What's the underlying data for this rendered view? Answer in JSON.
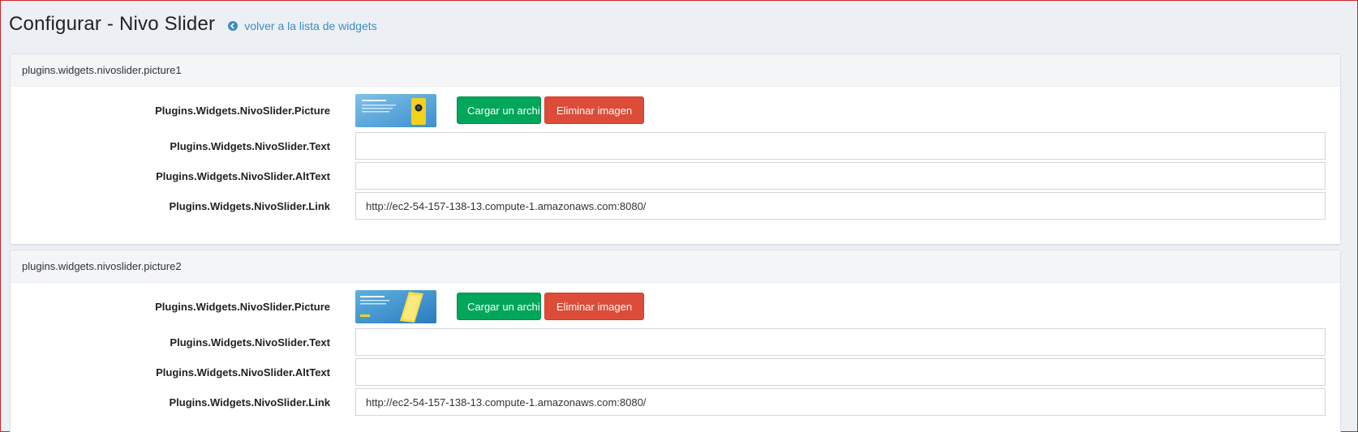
{
  "header": {
    "title": "Configurar - Nivo Slider",
    "back_link": "volver a la lista de widgets"
  },
  "colors": {
    "accent": "#3c8dbc",
    "success": "#00a65a",
    "danger": "#dd4b39",
    "background": "#ecf0f5"
  },
  "panels": [
    {
      "heading": "plugins.widgets.nivoslider.picture1",
      "picture_label": "Plugins.Widgets.NivoSlider.Picture",
      "upload_label": "Cargar un archivo",
      "delete_label": "Eliminar imagen",
      "text_label": "Plugins.Widgets.NivoSlider.Text",
      "text_value": "",
      "alt_label": "Plugins.Widgets.NivoSlider.AltText",
      "alt_value": "",
      "link_label": "Plugins.Widgets.NivoSlider.Link",
      "link_value": "http://ec2-54-157-138-13.compute-1.amazonaws.com:8080/"
    },
    {
      "heading": "plugins.widgets.nivoslider.picture2",
      "picture_label": "Plugins.Widgets.NivoSlider.Picture",
      "upload_label": "Cargar un archivo",
      "delete_label": "Eliminar imagen",
      "text_label": "Plugins.Widgets.NivoSlider.Text",
      "text_value": "",
      "alt_label": "Plugins.Widgets.NivoSlider.AltText",
      "alt_value": "",
      "link_label": "Plugins.Widgets.NivoSlider.Link",
      "link_value": "http://ec2-54-157-138-13.compute-1.amazonaws.com:8080/"
    }
  ]
}
